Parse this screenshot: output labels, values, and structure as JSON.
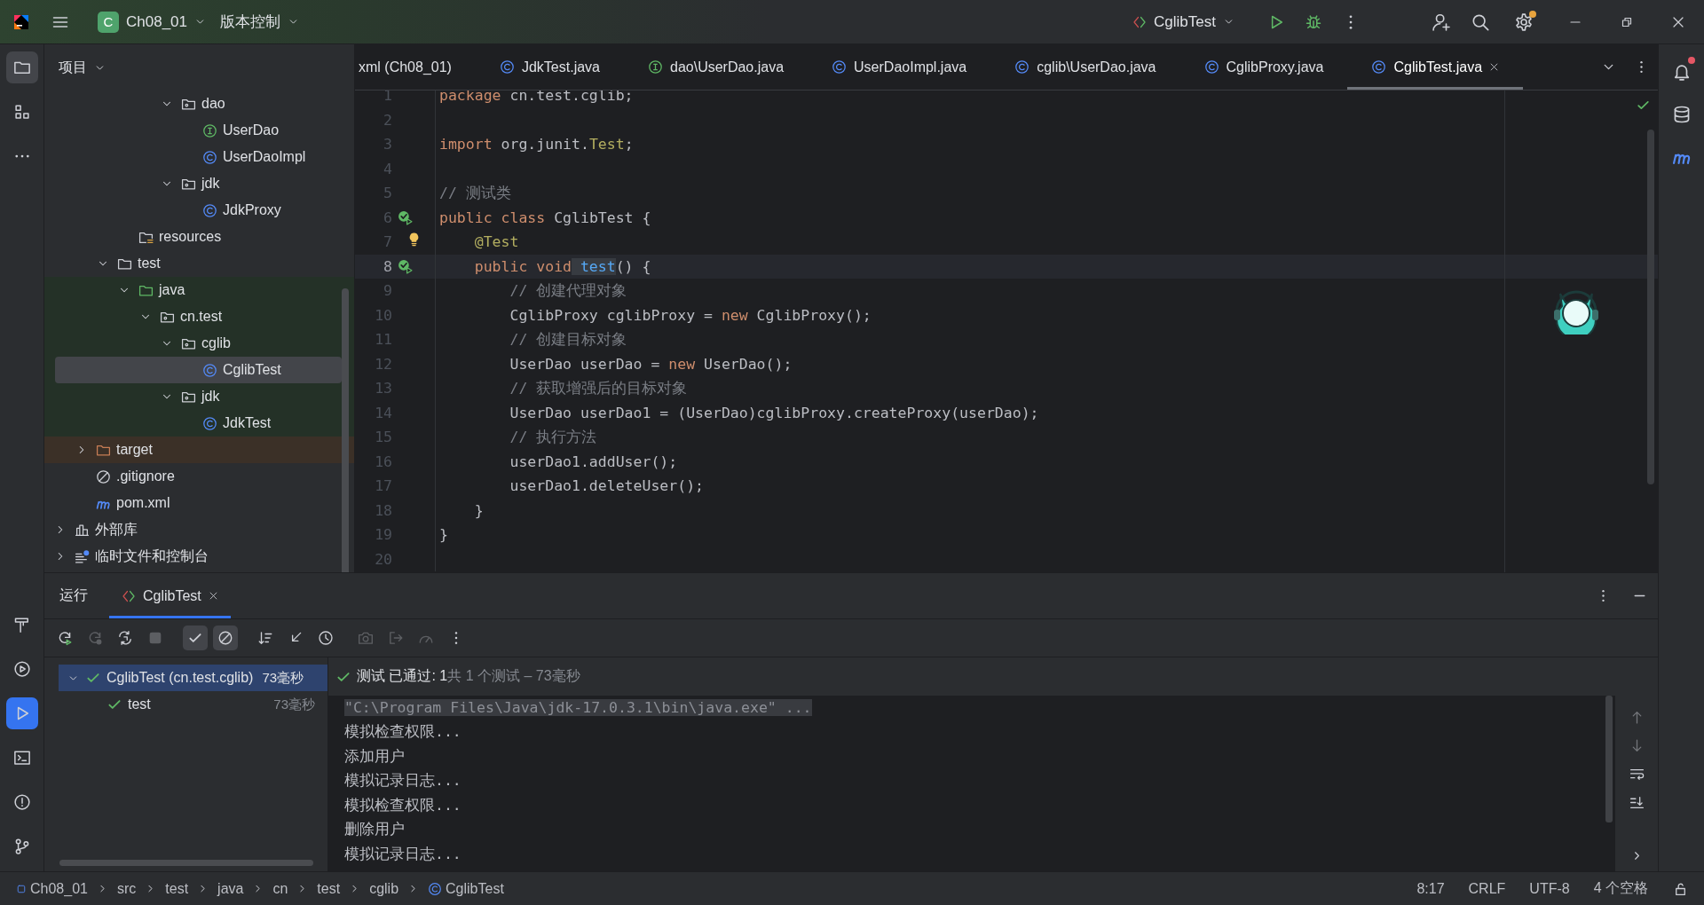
{
  "titlebar": {
    "project_badge": "C",
    "project": "Ch08_01",
    "vcs": "版本控制",
    "run_config": "CglibTest",
    "settings_update": true
  },
  "left_toolbar": [
    {
      "kind": "project",
      "selected": true
    },
    {
      "kind": "structure",
      "selected": false
    },
    {
      "kind": "more",
      "selected": false
    }
  ],
  "left_toolbar_bottom": [
    {
      "kind": "build",
      "selected": false
    },
    {
      "kind": "services",
      "selected": false
    },
    {
      "kind": "run",
      "selected": true
    },
    {
      "kind": "terminal",
      "selected": false
    },
    {
      "kind": "problems",
      "selected": false
    },
    {
      "kind": "git",
      "selected": false
    }
  ],
  "right_toolbar": [
    {
      "kind": "notifications",
      "badge": true
    },
    {
      "kind": "database",
      "badge": false
    },
    {
      "kind": "maven",
      "badge": false
    }
  ],
  "project_panel": {
    "title": "项目",
    "tree": [
      {
        "children": [
          {
            "children": [
              {
                "children": [
                  {
                    "children": [
                      {
                        "children": [
                          {
                            "label": "dao",
                            "kind": "package",
                            "expanded": true,
                            "selected": false,
                            "children": [
                              {
                                "label": "UserDao",
                                "kind": "interface",
                                "selected": false
                              },
                              {
                                "label": "UserDaoImpl",
                                "kind": "class",
                                "selected": false
                              }
                            ]
                          },
                          {
                            "label": "jdk",
                            "kind": "package",
                            "expanded": true,
                            "selected": false,
                            "children": [
                              {
                                "label": "JdkProxy",
                                "kind": "class",
                                "selected": false
                              }
                            ]
                          }
                        ]
                      }
                    ]
                  },
                  {
                    "label": "resources",
                    "kind": "resources",
                    "selected": false
                  }
                ]
              },
              {
                "label": "test",
                "kind": "folder",
                "expanded": true,
                "selected": false,
                "children": [
                  {
                    "label": "java",
                    "kind": "test-root",
                    "expanded": true,
                    "selected": false,
                    "children": [
                      {
                        "label": "cn.test",
                        "kind": "package",
                        "expanded": true,
                        "selected": false,
                        "children": [
                          {
                            "label": "cglib",
                            "kind": "package",
                            "expanded": true,
                            "selected": false,
                            "children": [
                              {
                                "label": "CglibTest",
                                "kind": "class",
                                "selected": true
                              }
                            ]
                          },
                          {
                            "label": "jdk",
                            "kind": "package",
                            "expanded": true,
                            "selected": false,
                            "children": [
                              {
                                "label": "JdkTest",
                                "kind": "class",
                                "selected": false
                              }
                            ]
                          }
                        ]
                      }
                    ]
                  }
                ]
              }
            ]
          },
          {
            "label": "target",
            "kind": "excluded",
            "expanded": false,
            "selected": false
          },
          {
            "label": ".gitignore",
            "kind": "gitignore",
            "selected": false
          },
          {
            "label": "pom.xml",
            "kind": "maven",
            "selected": false
          }
        ]
      },
      {
        "label": "外部库",
        "kind": "library",
        "expanded": false,
        "selected": false
      },
      {
        "label": "临时文件和控制台",
        "kind": "scratch",
        "expanded": false,
        "selected": false
      }
    ]
  },
  "editor": {
    "tabs": [
      {
        "label": "xml (Ch08_01)",
        "selected": false
      },
      {
        "label": "JdkTest.java",
        "kind": "class",
        "selected": false
      },
      {
        "label": "dao\\UserDao.java",
        "kind": "interface",
        "selected": false
      },
      {
        "label": "UserDaoImpl.java",
        "kind": "class",
        "selected": false
      },
      {
        "label": "cglib\\UserDao.java",
        "kind": "class",
        "selected": false
      },
      {
        "label": "CglibProxy.java",
        "kind": "class",
        "selected": false
      },
      {
        "label": "CglibTest.java",
        "kind": "class",
        "selected": true
      }
    ],
    "lines": [
      {
        "no": "1",
        "run_gutter": false,
        "intention": false,
        "current": false,
        "tokens": [
          {
            "kind": "keyword",
            "text": "package"
          },
          {
            "kind": "plain",
            "text": "cn.test.cglib;"
          }
        ]
      },
      {
        "no": "2",
        "run_gutter": false,
        "intention": false,
        "current": false
      },
      {
        "no": "3",
        "run_gutter": false,
        "intention": false,
        "current": false,
        "tokens": [
          {
            "kind": "keyword",
            "text": "import"
          },
          {
            "kind": "plain",
            "text": "org.junit.",
            "glued": false
          },
          {
            "kind": "annotation",
            "text": "Test",
            "glued": true
          },
          {
            "kind": "plain",
            "text": ";",
            "glued": true
          }
        ]
      },
      {
        "no": "4",
        "run_gutter": false,
        "intention": false,
        "current": false
      },
      {
        "no": "5",
        "run_gutter": false,
        "intention": false,
        "current": false,
        "tokens": [
          {
            "kind": "comment",
            "text": "// 测试类"
          }
        ]
      },
      {
        "no": "6",
        "run_gutter": true,
        "intention": false,
        "current": false,
        "tokens": [
          {
            "kind": "keyword",
            "text": "public class"
          },
          {
            "kind": "plain",
            "text": "CglibTest {"
          }
        ],
        "children": [
          {
            "no": "7",
            "run_gutter": false,
            "intention": true,
            "current": false,
            "tokens": [
              {
                "kind": "annotation",
                "text": "@Test"
              }
            ]
          },
          {
            "no": "8",
            "run_gutter": true,
            "intention": false,
            "current": true,
            "tokens": [
              {
                "kind": "keyword",
                "text": "public void"
              },
              {
                "kind": "method",
                "text": "test"
              },
              {
                "kind": "plain",
                "text": "() {",
                "glued": true
              }
            ],
            "children": [
              {
                "no": "9",
                "run_gutter": false,
                "intention": false,
                "current": false,
                "tokens": [
                  {
                    "kind": "comment",
                    "text": "// 创建代理对象"
                  }
                ]
              },
              {
                "no": "10",
                "run_gutter": false,
                "intention": false,
                "current": false,
                "tokens": [
                  {
                    "kind": "plain",
                    "text": "CglibProxy cglibProxy ="
                  },
                  {
                    "kind": "keyword",
                    "text": "new"
                  },
                  {
                    "kind": "plain",
                    "text": "CglibProxy();"
                  }
                ]
              },
              {
                "no": "11",
                "run_gutter": false,
                "intention": false,
                "current": false,
                "tokens": [
                  {
                    "kind": "comment",
                    "text": "// 创建目标对象"
                  }
                ]
              },
              {
                "no": "12",
                "run_gutter": false,
                "intention": false,
                "current": false,
                "tokens": [
                  {
                    "kind": "plain",
                    "text": "UserDao userDao ="
                  },
                  {
                    "kind": "keyword",
                    "text": "new"
                  },
                  {
                    "kind": "plain",
                    "text": "UserDao();"
                  }
                ]
              },
              {
                "no": "13",
                "run_gutter": false,
                "intention": false,
                "current": false,
                "tokens": [
                  {
                    "kind": "comment",
                    "text": "// 获取增强后的目标对象"
                  }
                ]
              },
              {
                "no": "14",
                "run_gutter": false,
                "intention": false,
                "current": false,
                "tokens": [
                  {
                    "kind": "plain",
                    "text": "UserDao userDao1 = (UserDao)cglibProxy.createProxy(userDao);"
                  }
                ]
              },
              {
                "no": "15",
                "run_gutter": false,
                "intention": false,
                "current": false,
                "tokens": [
                  {
                    "kind": "comment",
                    "text": "// 执行方法"
                  }
                ]
              },
              {
                "no": "16",
                "run_gutter": false,
                "intention": false,
                "current": false,
                "tokens": [
                  {
                    "kind": "plain",
                    "text": "userDao1.addUser();"
                  }
                ]
              },
              {
                "no": "17",
                "run_gutter": false,
                "intention": false,
                "current": false,
                "tokens": [
                  {
                    "kind": "plain",
                    "text": "userDao1.deleteUser();"
                  }
                ]
              }
            ]
          },
          {
            "no": "18",
            "run_gutter": false,
            "intention": false,
            "current": false,
            "tokens": [
              {
                "kind": "plain",
                "text": "}"
              }
            ]
          }
        ]
      },
      {
        "no": "19",
        "run_gutter": false,
        "intention": false,
        "current": false,
        "tokens": [
          {
            "kind": "plain",
            "text": "}"
          }
        ]
      },
      {
        "no": "20",
        "run_gutter": false,
        "intention": false,
        "current": false
      }
    ]
  },
  "run_panel": {
    "title": "运行",
    "tabs": [
      {
        "label": "CglibTest",
        "selected": true
      }
    ],
    "toolbar": [
      {
        "kind": "rerun",
        "disabled": false
      },
      {
        "kind": "rerun-failed",
        "disabled": true
      },
      {
        "kind": "auto-test",
        "disabled": false
      },
      {
        "kind": "stop",
        "disabled": true
      },
      {
        "kind": "show-passed",
        "on": true,
        "disabled": false
      },
      {
        "kind": "show-ignored",
        "on": true,
        "disabled": false
      },
      {
        "kind": "sort",
        "disabled": false
      },
      {
        "kind": "import",
        "disabled": false
      },
      {
        "kind": "history",
        "disabled": false
      },
      {
        "kind": "screenshot",
        "disabled": true
      },
      {
        "kind": "export",
        "disabled": true
      },
      {
        "kind": "coverage",
        "disabled": true
      },
      {
        "kind": "more",
        "disabled": false
      }
    ],
    "tests": [
      {
        "label": "CglibTest (cn.test.cglib)",
        "time": "73毫秒",
        "passed": true,
        "expanded": true,
        "selected": true,
        "children": [
          {
            "label": "test",
            "time": "73毫秒",
            "passed": true,
            "selected": false
          }
        ]
      }
    ],
    "result": "测试 已通过: 1",
    "summary": "共 1 个测试 – 73毫秒",
    "console": [
      {
        "kind": "command",
        "text": "\"C:\\Program Files\\Java\\jdk-17.0.3.1\\bin\\java.exe\" ..."
      },
      {
        "kind": "output",
        "text": "模拟检查权限..."
      },
      {
        "kind": "output",
        "text": "添加用户"
      },
      {
        "kind": "output",
        "text": "模拟记录日志..."
      },
      {
        "kind": "output",
        "text": "模拟检查权限..."
      },
      {
        "kind": "output",
        "text": "删除用户"
      },
      {
        "kind": "output",
        "text": "模拟记录日志..."
      }
    ]
  },
  "status_bar": {
    "breadcrumbs": [
      {
        "label": "Ch08_01"
      },
      {
        "label": "src"
      },
      {
        "label": "test"
      },
      {
        "label": "java"
      },
      {
        "label": "cn"
      },
      {
        "label": "test"
      },
      {
        "label": "cglib"
      },
      {
        "label": "CglibTest"
      }
    ],
    "position": "8:17",
    "line_separator": "CRLF",
    "encoding": "UTF-8",
    "indent": "4 个空格"
  }
}
